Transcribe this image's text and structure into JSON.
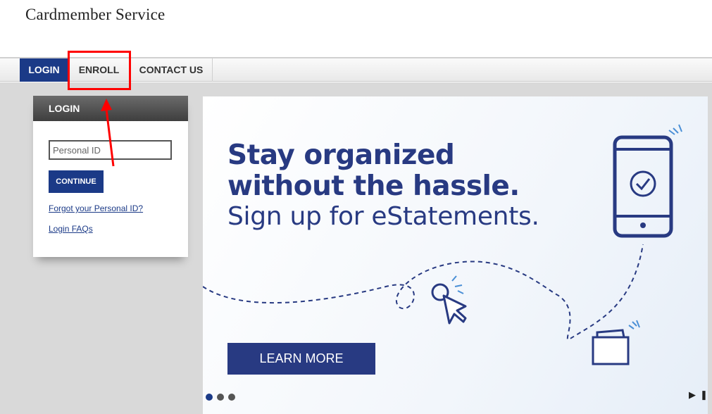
{
  "brand": {
    "title": "Cardmember Service"
  },
  "nav": {
    "items": [
      "LOGIN",
      "ENROLL",
      "CONTACT US"
    ]
  },
  "login": {
    "header": "LOGIN",
    "personal_id_placeholder": "Personal ID",
    "continue_label": "CONTINUE",
    "forgot_link": "Forgot your Personal ID?",
    "faq_link": "Login FAQs"
  },
  "banner": {
    "headline_line1": "Stay organized",
    "headline_line2": "without the hassle.",
    "subhead": "Sign up for eStatements.",
    "cta": "LEARN MORE",
    "slide_count": 3,
    "active_slide": 1,
    "play_glyph": "▶",
    "pause_glyph": "❚❚"
  },
  "colors": {
    "brand_navy": "#1b3a87",
    "banner_navy": "#283a82",
    "annotation_red": "#ff0000"
  },
  "icons": [
    "smartphone-check-icon",
    "cursor-click-icon",
    "folder-document-icon",
    "play-icon",
    "pause-icon"
  ]
}
